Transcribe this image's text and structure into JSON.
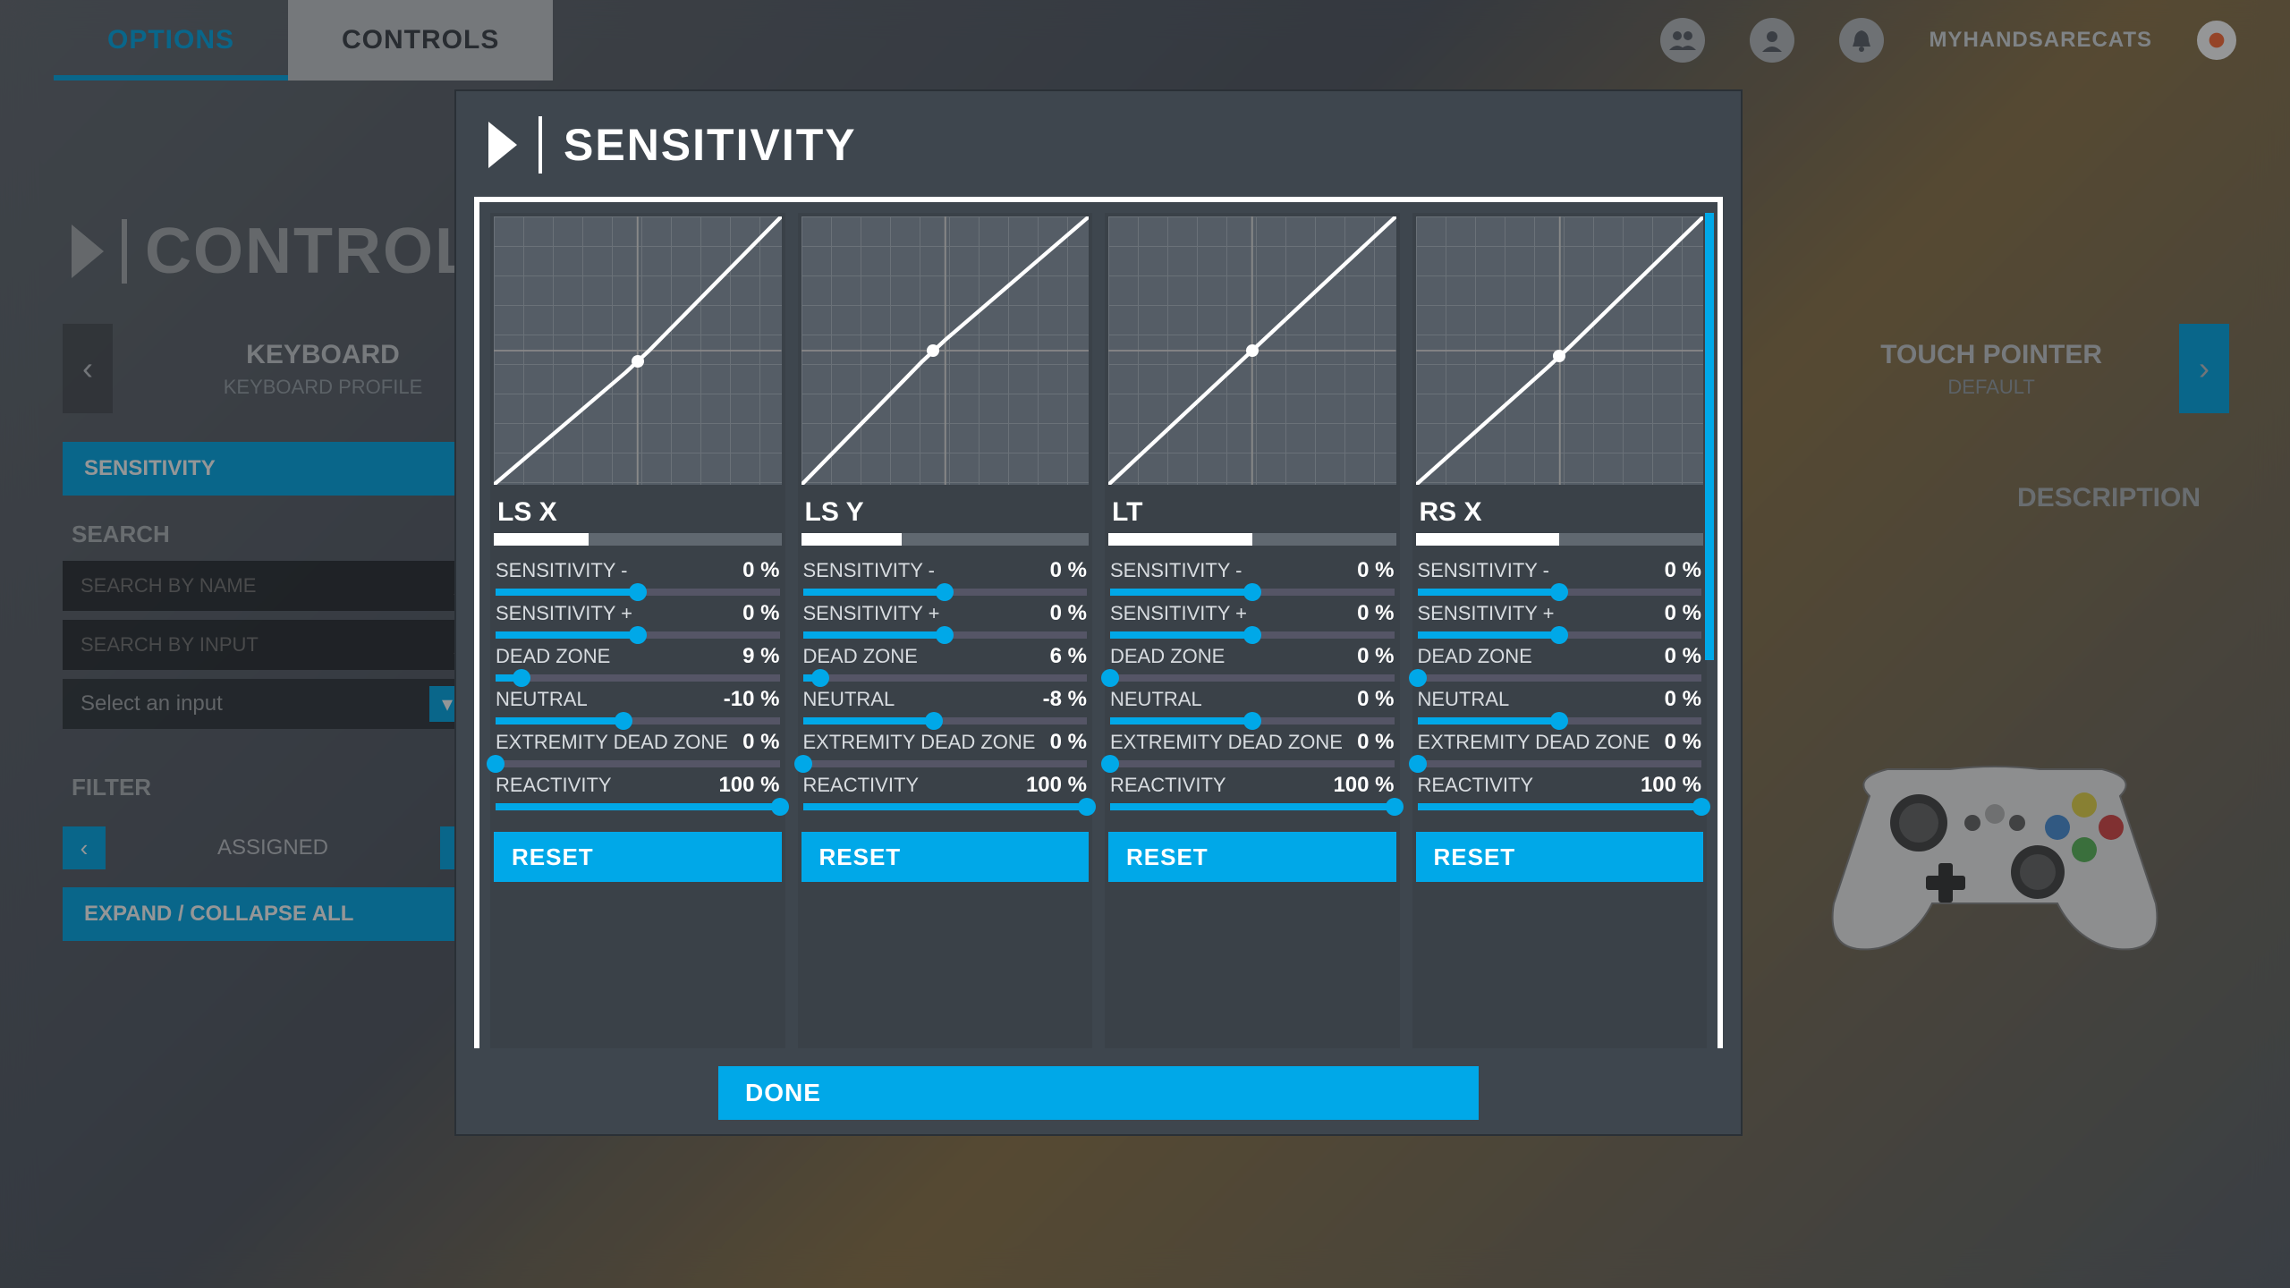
{
  "topbar": {
    "tabs": [
      {
        "label": "OPTIONS",
        "state": "active"
      },
      {
        "label": "CONTROLS",
        "state": "current"
      }
    ],
    "username": "MYHANDSARECATS"
  },
  "page": {
    "title": "CONTROLS",
    "devices": [
      {
        "name": "KEYBOARD",
        "profile": "KEYBOARD PROFILE"
      },
      {
        "name": "TOUCH POINTER",
        "profile": "DEFAULT"
      }
    ],
    "sidebar": {
      "sensitivity": "SENSITIVITY",
      "search_heading": "SEARCH",
      "search_name_ph": "SEARCH BY NAME",
      "search_input_ph": "SEARCH BY INPUT",
      "select_ph": "Select an input",
      "filter_heading": "FILTER",
      "filter_value": "ASSIGNED",
      "expand": "EXPAND / COLLAPSE ALL"
    },
    "description_label": "DESCRIPTION"
  },
  "modal": {
    "title": "SENSITIVITY",
    "done": "DONE",
    "reset": "RESET",
    "slider_labels": {
      "sens_minus": "SENSITIVITY -",
      "sens_plus": "SENSITIVITY +",
      "dead_zone": "DEAD ZONE",
      "neutral": "NEUTRAL",
      "ext_dead": "EXTREMITY DEAD ZONE",
      "reactivity": "REACTIVITY"
    },
    "axes": [
      {
        "name": "LS X",
        "input_fill": 33,
        "curve_dot": {
          "x": 50,
          "y": 46
        },
        "sens_minus": {
          "val": "0 %",
          "pos": 50
        },
        "sens_plus": {
          "val": "0 %",
          "pos": 50
        },
        "dead_zone": {
          "val": "9 %",
          "pos": 9
        },
        "neutral": {
          "val": "-10 %",
          "pos": 45
        },
        "ext_dead": {
          "val": "0 %",
          "pos": 0
        },
        "reactivity": {
          "val": "100 %",
          "pos": 100
        }
      },
      {
        "name": "LS Y",
        "input_fill": 35,
        "curve_dot": {
          "x": 46,
          "y": 50
        },
        "sens_minus": {
          "val": "0 %",
          "pos": 50
        },
        "sens_plus": {
          "val": "0 %",
          "pos": 50
        },
        "dead_zone": {
          "val": "6 %",
          "pos": 6
        },
        "neutral": {
          "val": "-8 %",
          "pos": 46
        },
        "ext_dead": {
          "val": "0 %",
          "pos": 0
        },
        "reactivity": {
          "val": "100 %",
          "pos": 100
        }
      },
      {
        "name": "LT",
        "input_fill": 50,
        "curve_dot": {
          "x": 50,
          "y": 50
        },
        "sens_minus": {
          "val": "0 %",
          "pos": 50
        },
        "sens_plus": {
          "val": "0 %",
          "pos": 50
        },
        "dead_zone": {
          "val": "0 %",
          "pos": 0
        },
        "neutral": {
          "val": "0 %",
          "pos": 50
        },
        "ext_dead": {
          "val": "0 %",
          "pos": 0
        },
        "reactivity": {
          "val": "100 %",
          "pos": 100
        }
      },
      {
        "name": "RS X",
        "input_fill": 50,
        "curve_dot": {
          "x": 50,
          "y": 48
        },
        "sens_minus": {
          "val": "0 %",
          "pos": 50
        },
        "sens_plus": {
          "val": "0 %",
          "pos": 50
        },
        "dead_zone": {
          "val": "0 %",
          "pos": 0
        },
        "neutral": {
          "val": "0 %",
          "pos": 50
        },
        "ext_dead": {
          "val": "0 %",
          "pos": 0
        },
        "reactivity": {
          "val": "100 %",
          "pos": 100
        }
      }
    ]
  }
}
